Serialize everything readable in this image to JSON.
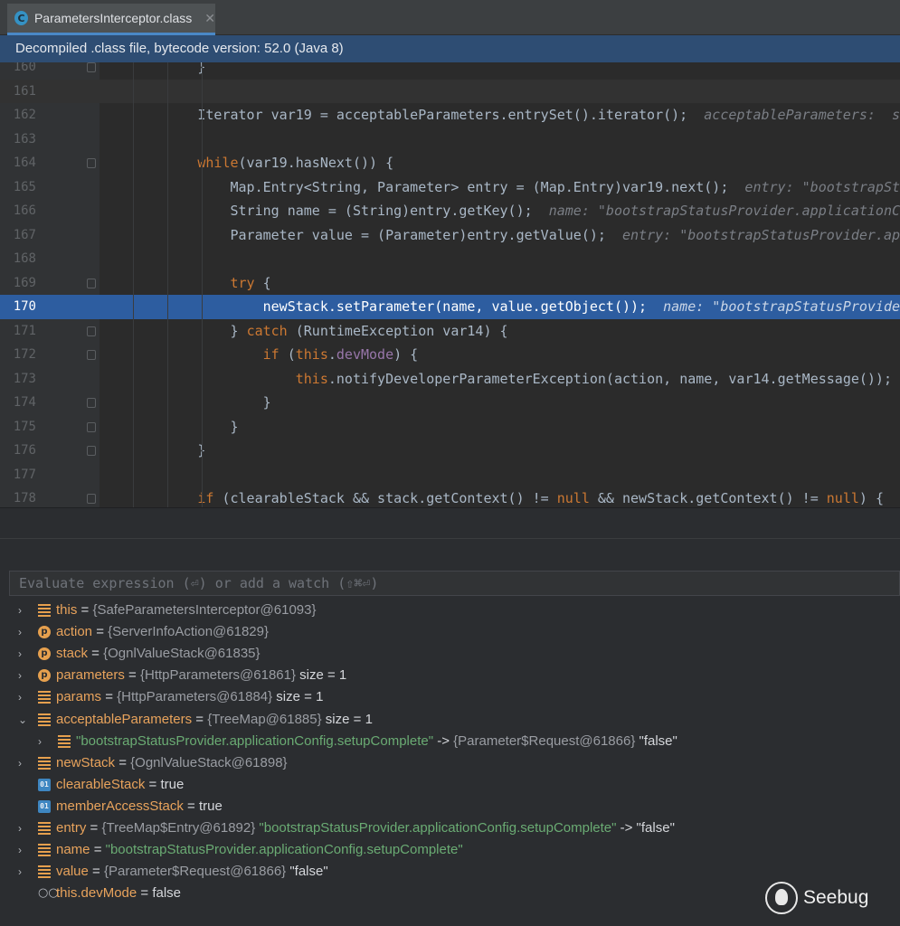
{
  "tab": {
    "icon": "C",
    "title": "ParametersInterceptor.class",
    "close": "✕"
  },
  "banner": {
    "text": "Decompiled .class file, bytecode version: 52.0 (Java 8)"
  },
  "editor": {
    "lines": [
      {
        "num": "160",
        "segments": [
          {
            "t": "            }",
            "c": "p"
          }
        ]
      },
      {
        "num": "161",
        "segments": []
      },
      {
        "num": "162",
        "segments": [
          {
            "t": "            Iterator var19 = acceptableParameters.entrySet().iterator();",
            "c": "p"
          },
          {
            "t": "  acceptableParameters:  s",
            "c": "h"
          }
        ]
      },
      {
        "num": "163",
        "segments": []
      },
      {
        "num": "164",
        "segments": [
          {
            "t": "            ",
            "c": "p"
          },
          {
            "t": "while",
            "c": "k"
          },
          {
            "t": "(var19.hasNext()) {",
            "c": "p"
          }
        ]
      },
      {
        "num": "165",
        "segments": [
          {
            "t": "                Map.Entry<String, Parameter> entry = (Map.Entry)var19.next();",
            "c": "p"
          },
          {
            "t": "  entry: \"bootstrapSt",
            "c": "h"
          }
        ]
      },
      {
        "num": "166",
        "segments": [
          {
            "t": "                String name = (String)entry.getKey();",
            "c": "p"
          },
          {
            "t": "  name: \"bootstrapStatusProvider.applicationC",
            "c": "h"
          }
        ]
      },
      {
        "num": "167",
        "segments": [
          {
            "t": "                Parameter value = (Parameter)entry.getValue();",
            "c": "p"
          },
          {
            "t": "  entry: \"bootstrapStatusProvider.ap",
            "c": "h"
          }
        ]
      },
      {
        "num": "168",
        "segments": []
      },
      {
        "num": "169",
        "segments": [
          {
            "t": "                ",
            "c": "p"
          },
          {
            "t": "try",
            "c": "k"
          },
          {
            "t": " {",
            "c": "p"
          }
        ]
      },
      {
        "num": "170",
        "segments": [
          {
            "t": "                    newStack.setParameter(name, value.getObject());",
            "c": "p"
          },
          {
            "t": "  name: \"bootstrapStatusProvide",
            "c": "h"
          }
        ]
      },
      {
        "num": "171",
        "segments": [
          {
            "t": "                } ",
            "c": "p"
          },
          {
            "t": "catch",
            "c": "k"
          },
          {
            "t": " (RuntimeException var14) {",
            "c": "p"
          }
        ]
      },
      {
        "num": "172",
        "segments": [
          {
            "t": "                    ",
            "c": "p"
          },
          {
            "t": "if",
            "c": "k"
          },
          {
            "t": " (",
            "c": "p"
          },
          {
            "t": "this",
            "c": "k"
          },
          {
            "t": ".",
            "c": "p"
          },
          {
            "t": "devMode",
            "c": "f"
          },
          {
            "t": ") {",
            "c": "p"
          }
        ]
      },
      {
        "num": "173",
        "segments": [
          {
            "t": "                        ",
            "c": "p"
          },
          {
            "t": "this",
            "c": "k"
          },
          {
            "t": ".notifyDeveloperParameterException(action, name, var14.getMessage());",
            "c": "p"
          }
        ]
      },
      {
        "num": "174",
        "segments": [
          {
            "t": "                    }",
            "c": "p"
          }
        ]
      },
      {
        "num": "175",
        "segments": [
          {
            "t": "                }",
            "c": "p"
          }
        ]
      },
      {
        "num": "176",
        "segments": [
          {
            "t": "            }",
            "c": "p"
          }
        ]
      },
      {
        "num": "177",
        "segments": []
      },
      {
        "num": "178",
        "segments": [
          {
            "t": "            ",
            "c": "p"
          },
          {
            "t": "if",
            "c": "k"
          },
          {
            "t": " (clearableStack && stack.getContext() != ",
            "c": "p"
          },
          {
            "t": "null",
            "c": "k"
          },
          {
            "t": " && newStack.getContext() != ",
            "c": "p"
          },
          {
            "t": "null",
            "c": "k"
          },
          {
            "t": ") {",
            "c": "p"
          }
        ]
      }
    ]
  },
  "debugger": {
    "eval_placeholder": "Evaluate expression (⏎) or add a watch (⇧⌘⏎)",
    "variables": [
      {
        "arrow": "›",
        "icon": "field",
        "parts": [
          {
            "t": "this",
            "c": "n"
          },
          {
            "t": " = ",
            "c": "e"
          },
          {
            "t": "{SafeParametersInterceptor@61093}",
            "c": "t"
          }
        ]
      },
      {
        "arrow": "›",
        "icon": "p",
        "parts": [
          {
            "t": "action",
            "c": "n"
          },
          {
            "t": " = ",
            "c": "e"
          },
          {
            "t": "{ServerInfoAction@61829}",
            "c": "t"
          }
        ]
      },
      {
        "arrow": "›",
        "icon": "p",
        "parts": [
          {
            "t": "stack",
            "c": "n"
          },
          {
            "t": " = ",
            "c": "e"
          },
          {
            "t": "{OgnlValueStack@61835}",
            "c": "t"
          }
        ]
      },
      {
        "arrow": "›",
        "icon": "p",
        "parts": [
          {
            "t": "parameters",
            "c": "n"
          },
          {
            "t": " = ",
            "c": "e"
          },
          {
            "t": "{HttpParameters@61861}",
            "c": "t"
          },
          {
            "t": "  size = 1",
            "c": "v"
          }
        ]
      },
      {
        "arrow": "›",
        "icon": "field",
        "parts": [
          {
            "t": "params",
            "c": "n"
          },
          {
            "t": " = ",
            "c": "e"
          },
          {
            "t": "{HttpParameters@61884}",
            "c": "t"
          },
          {
            "t": "  size = 1",
            "c": "v"
          }
        ]
      },
      {
        "arrow": "⌄",
        "icon": "field",
        "parts": [
          {
            "t": "acceptableParameters",
            "c": "n"
          },
          {
            "t": " = ",
            "c": "e"
          },
          {
            "t": "{TreeMap@61885}",
            "c": "t"
          },
          {
            "t": "  size = 1",
            "c": "v"
          }
        ]
      },
      {
        "arrow": "›",
        "icon": "field",
        "indent": true,
        "parts": [
          {
            "t": "\"bootstrapStatusProvider.applicationConfig.setupComplete\"",
            "c": "s"
          },
          {
            "t": " -> ",
            "c": "e"
          },
          {
            "t": "{Parameter$Request@61866}",
            "c": "t"
          },
          {
            "t": " \"false\"",
            "c": "v"
          }
        ]
      },
      {
        "arrow": "›",
        "icon": "field",
        "parts": [
          {
            "t": "newStack",
            "c": "n"
          },
          {
            "t": " = ",
            "c": "e"
          },
          {
            "t": "{OgnlValueStack@61898}",
            "c": "t"
          }
        ]
      },
      {
        "arrow": "",
        "icon": "bool",
        "parts": [
          {
            "t": "clearableStack",
            "c": "n"
          },
          {
            "t": " = ",
            "c": "e"
          },
          {
            "t": "true",
            "c": "v"
          }
        ]
      },
      {
        "arrow": "",
        "icon": "bool",
        "parts": [
          {
            "t": "memberAccessStack",
            "c": "n"
          },
          {
            "t": " = ",
            "c": "e"
          },
          {
            "t": "true",
            "c": "v"
          }
        ]
      },
      {
        "arrow": "›",
        "icon": "field",
        "parts": [
          {
            "t": "entry",
            "c": "n"
          },
          {
            "t": " = ",
            "c": "e"
          },
          {
            "t": "{TreeMap$Entry@61892}",
            "c": "t"
          },
          {
            "t": " \"bootstrapStatusProvider.applicationConfig.setupComplete\"",
            "c": "s"
          },
          {
            "t": " -> \"false\"",
            "c": "v"
          }
        ]
      },
      {
        "arrow": "›",
        "icon": "field",
        "parts": [
          {
            "t": "name",
            "c": "n"
          },
          {
            "t": " = ",
            "c": "e"
          },
          {
            "t": "\"bootstrapStatusProvider.applicationConfig.setupComplete\"",
            "c": "s"
          }
        ]
      },
      {
        "arrow": "›",
        "icon": "field",
        "parts": [
          {
            "t": "value",
            "c": "n"
          },
          {
            "t": " = ",
            "c": "e"
          },
          {
            "t": "{Parameter$Request@61866}",
            "c": "t"
          },
          {
            "t": " \"false\"",
            "c": "v"
          }
        ]
      },
      {
        "arrow": "",
        "icon": "watch",
        "parts": [
          {
            "t": "this.devMode",
            "c": "n"
          },
          {
            "t": " = ",
            "c": "e"
          },
          {
            "t": "false",
            "c": "v"
          }
        ]
      }
    ]
  },
  "watermark": {
    "text": "Seebug"
  }
}
